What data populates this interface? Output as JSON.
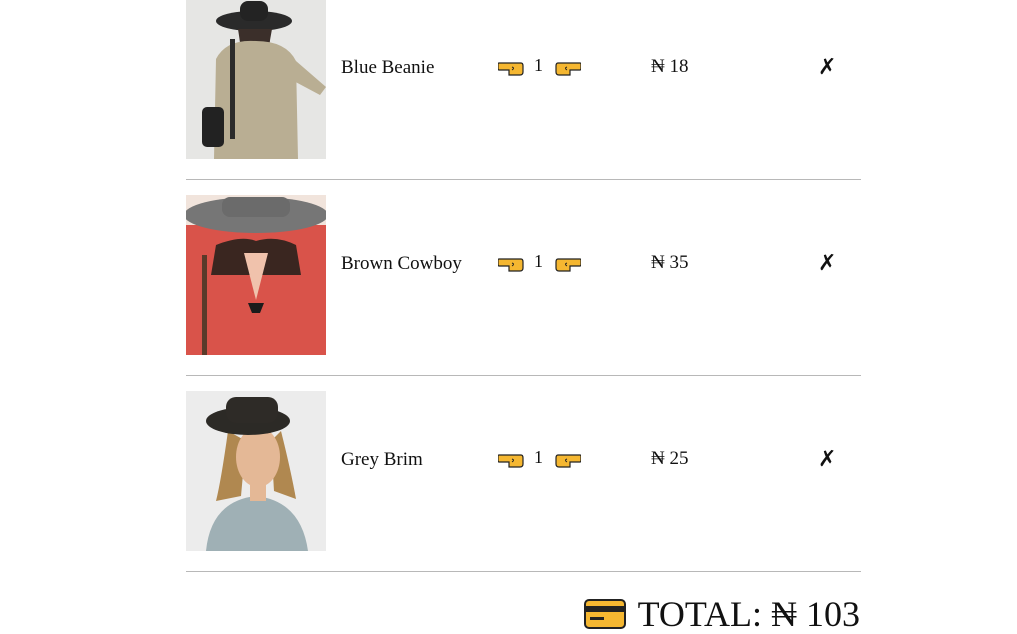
{
  "currency": "₦",
  "cart": {
    "items": [
      {
        "name": "Blue Beanie",
        "quantity": "1",
        "price": "₦ 18",
        "remove_label": "✗"
      },
      {
        "name": "Brown Cowboy",
        "quantity": "1",
        "price": "₦ 35",
        "remove_label": "✗"
      },
      {
        "name": "Grey Brim",
        "quantity": "1",
        "price": "₦ 25",
        "remove_label": "✗"
      }
    ],
    "decrease_icon": "hand-pointing-left-icon",
    "increase_icon": "hand-pointing-right-icon"
  },
  "summary": {
    "label": "TOTAL:",
    "value": "₦ 103",
    "icon": "credit-card-icon",
    "icon_color": "#f5b731"
  }
}
